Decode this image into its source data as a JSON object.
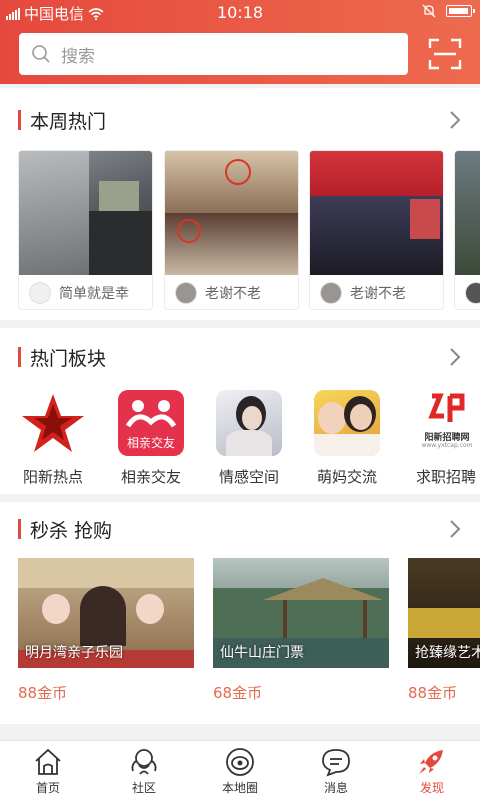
{
  "status_bar": {
    "carrier": "中国电信",
    "time": "10:18"
  },
  "search": {
    "placeholder": "搜索"
  },
  "weekly_hot": {
    "title": "本周热门",
    "cards": [
      {
        "author": "简单就是幸"
      },
      {
        "author": "老谢不老"
      },
      {
        "author": "老谢不老"
      }
    ]
  },
  "boards": {
    "title": "热门板块",
    "items": [
      {
        "label": "阳新热点",
        "icon": "star-logo-icon"
      },
      {
        "label": "相亲交友",
        "icon_text": "相亲交友",
        "icon": "matchmaking-icon"
      },
      {
        "label": "情感空间",
        "icon": "emotion-photo-icon"
      },
      {
        "label": "萌妈交流",
        "icon": "mom-photo-icon"
      },
      {
        "label": "求职招聘",
        "icon_text": "阳新招聘网",
        "icon_url_text": "www.yxtcap.com",
        "icon": "jobs-logo-icon"
      }
    ]
  },
  "flash_sale": {
    "title": "秒杀 抢购",
    "items": [
      {
        "name": "明月湾亲子乐园",
        "price": "88金币"
      },
      {
        "name": "仙牛山庄门票",
        "price": "68金币"
      },
      {
        "name": "抢臻缘艺术",
        "price": "88金币"
      }
    ]
  },
  "tabbar": {
    "items": [
      {
        "label": "首页"
      },
      {
        "label": "社区"
      },
      {
        "label": "本地圈"
      },
      {
        "label": "消息"
      },
      {
        "label": "发现"
      }
    ]
  },
  "colors": {
    "accent": "#e5493d",
    "price": "#e36a4f"
  }
}
